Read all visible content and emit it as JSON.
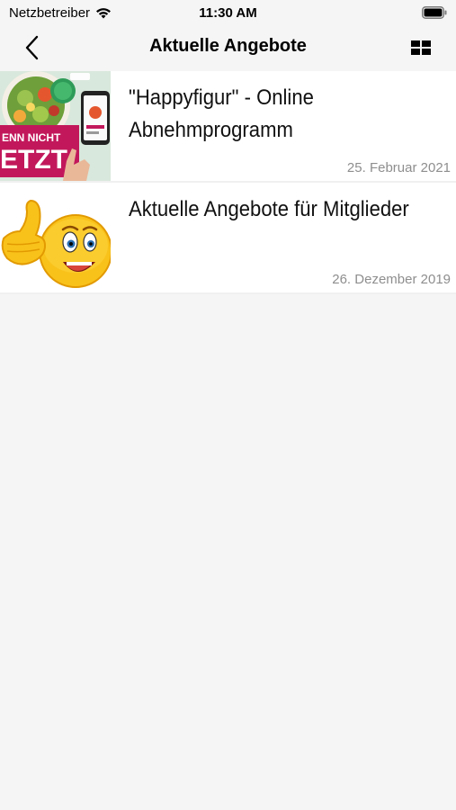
{
  "status_bar": {
    "carrier": "Netzbetreiber",
    "time": "11:30 AM"
  },
  "nav": {
    "title": "Aktuelle Angebote",
    "back_icon": "chevron-left-icon",
    "grid_icon": "grid-icon"
  },
  "items": [
    {
      "title": "\"Happyfigur\" - Online Abnehmprogramm",
      "date": "25. Februar 2021",
      "thumbnail": "happyfigur-thumbnail",
      "thumb_text": "ENN NICHT ETZT"
    },
    {
      "title": "Aktuelle Angebote für Mitglieder",
      "date": "26. Dezember 2019",
      "thumbnail": "thumbs-up-smiley-thumbnail"
    }
  ],
  "colors": {
    "background": "#f5f5f5",
    "card": "#ffffff",
    "date_text": "#8e8e8e",
    "accent_magenta": "#c2185b"
  }
}
